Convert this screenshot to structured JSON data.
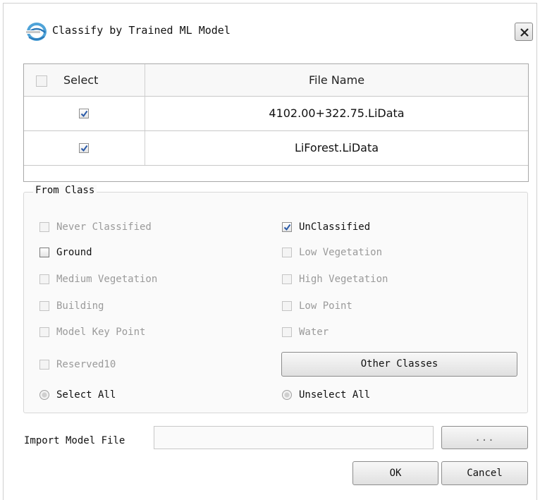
{
  "window": {
    "title": "Classify by Trained ML Model",
    "icon": "app-logo-icon",
    "close_icon": "close-icon"
  },
  "file_table": {
    "columns": [
      "Select",
      "File Name"
    ],
    "rows": [
      {
        "checked": true,
        "file_name": "4102.00+322.75.LiData"
      },
      {
        "checked": true,
        "file_name": "LiForest.LiData"
      }
    ]
  },
  "from_class": {
    "label": "From Class",
    "options": [
      {
        "label": "Never Classified",
        "checked": false,
        "enabled": false
      },
      {
        "label": "UnClassified",
        "checked": true,
        "enabled": true
      },
      {
        "label": "Ground",
        "checked": false,
        "enabled": true
      },
      {
        "label": "Low Vegetation",
        "checked": false,
        "enabled": false
      },
      {
        "label": "Medium Vegetation",
        "checked": false,
        "enabled": false
      },
      {
        "label": "High Vegetation",
        "checked": false,
        "enabled": false
      },
      {
        "label": "Building",
        "checked": false,
        "enabled": false
      },
      {
        "label": "Low Point",
        "checked": false,
        "enabled": false
      },
      {
        "label": "Model Key Point",
        "checked": false,
        "enabled": false
      },
      {
        "label": "Water",
        "checked": false,
        "enabled": false
      },
      {
        "label": "Reserved10",
        "checked": false,
        "enabled": false
      }
    ],
    "other_classes_button": "Other Classes",
    "select_all": "Select All",
    "unselect_all": "Unselect All"
  },
  "import": {
    "label": "Import Model File",
    "value": "",
    "browse_button": "..."
  },
  "buttons": {
    "ok": "OK",
    "cancel": "Cancel"
  },
  "colors": {
    "check": "#2a5aa8",
    "disabled_text": "#9a9a9a",
    "border": "#a8a8a8"
  }
}
